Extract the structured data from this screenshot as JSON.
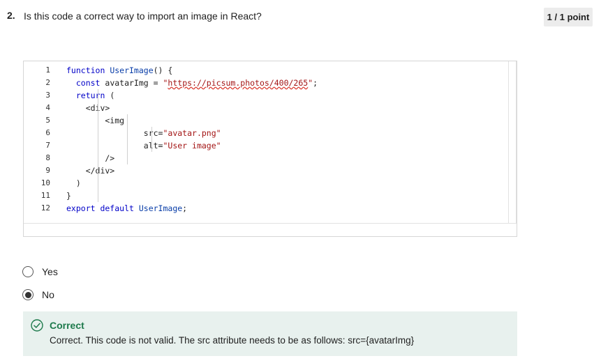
{
  "question": {
    "number": "2.",
    "text": "Is this code a correct way to import an image in React?",
    "points": "1 / 1 point"
  },
  "code": {
    "line_numbers": [
      "1",
      "2",
      "3",
      "4",
      "5",
      "6",
      "7",
      "8",
      "9",
      "10",
      "11",
      "12"
    ],
    "lines": [
      [
        {
          "t": "function ",
          "c": "kw"
        },
        {
          "t": "UserImage",
          "c": "fn"
        },
        {
          "t": "() {",
          "c": "plain"
        }
      ],
      [
        {
          "t": "  const ",
          "c": "kw"
        },
        {
          "t": "avatarImg = ",
          "c": "plain"
        },
        {
          "t": "\"",
          "c": "str"
        },
        {
          "t": "https://picsum.photos/400/265",
          "c": "url"
        },
        {
          "t": "\"",
          "c": "str"
        },
        {
          "t": ";",
          "c": "plain"
        }
      ],
      [
        {
          "t": "  return ",
          "c": "kw"
        },
        {
          "t": "(",
          "c": "plain"
        }
      ],
      [
        {
          "t": "    <div>",
          "c": "plain"
        }
      ],
      [
        {
          "t": "        <img",
          "c": "plain"
        }
      ],
      [
        {
          "t": "                src=",
          "c": "plain"
        },
        {
          "t": "\"avatar.png\"",
          "c": "str"
        }
      ],
      [
        {
          "t": "                alt=",
          "c": "plain"
        },
        {
          "t": "\"User image\"",
          "c": "str"
        }
      ],
      [
        {
          "t": "        />",
          "c": "plain"
        }
      ],
      [
        {
          "t": "    </div>",
          "c": "plain"
        }
      ],
      [
        {
          "t": "  )",
          "c": "plain"
        }
      ],
      [
        {
          "t": "}",
          "c": "plain"
        }
      ],
      [
        {
          "t": "export default ",
          "c": "kw"
        },
        {
          "t": "UserImage",
          "c": "fn"
        },
        {
          "t": ";",
          "c": "plain"
        }
      ]
    ]
  },
  "options": [
    {
      "label": "Yes",
      "selected": false
    },
    {
      "label": "No",
      "selected": true
    }
  ],
  "feedback": {
    "title": "Correct",
    "text": "Correct. This code is not valid. The src attribute needs to be as follows: src={avatarImg}",
    "color": "#1e7a4c"
  }
}
